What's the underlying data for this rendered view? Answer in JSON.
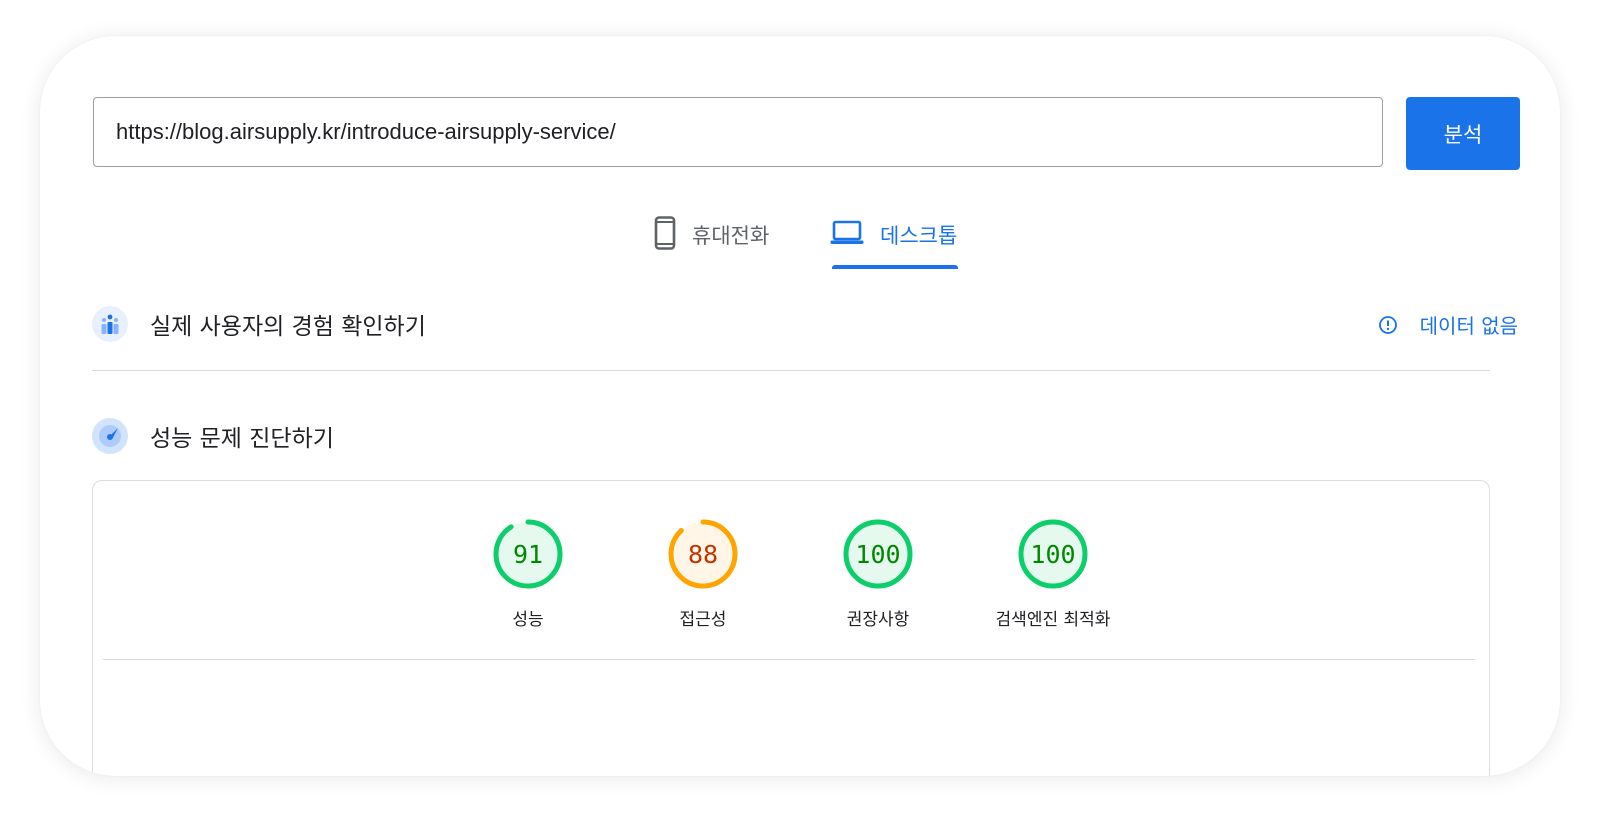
{
  "search": {
    "url_value": "https://blog.airsupply.kr/introduce-airsupply-service/",
    "analyze_label": "분석"
  },
  "tabs": [
    {
      "label": "휴대전화",
      "icon": "smartphone-icon",
      "active": false
    },
    {
      "label": "데스크톱",
      "icon": "laptop-icon",
      "active": true
    }
  ],
  "field_data": {
    "title": "실제 사용자의 경험 확인하기",
    "icon": "users-chart-icon",
    "status_label": "데이터 없음",
    "status_icon": "info-icon"
  },
  "lab_data": {
    "title": "성능 문제 진단하기",
    "icon": "gauge-icon",
    "scores": [
      {
        "label": "성능",
        "value": 91,
        "status": "good"
      },
      {
        "label": "접근성",
        "value": 88,
        "status": "average"
      },
      {
        "label": "권장사항",
        "value": 100,
        "status": "good"
      },
      {
        "label": "검색엔진 최적화",
        "value": 100,
        "status": "good"
      }
    ]
  },
  "colors": {
    "accent": "#1a73e8",
    "good": "#0cce6b",
    "good_text": "#008800",
    "good_fill": "#e6f9ee",
    "average": "#ffa400",
    "average_text": "#c33300",
    "average_fill": "#fff6e8"
  }
}
